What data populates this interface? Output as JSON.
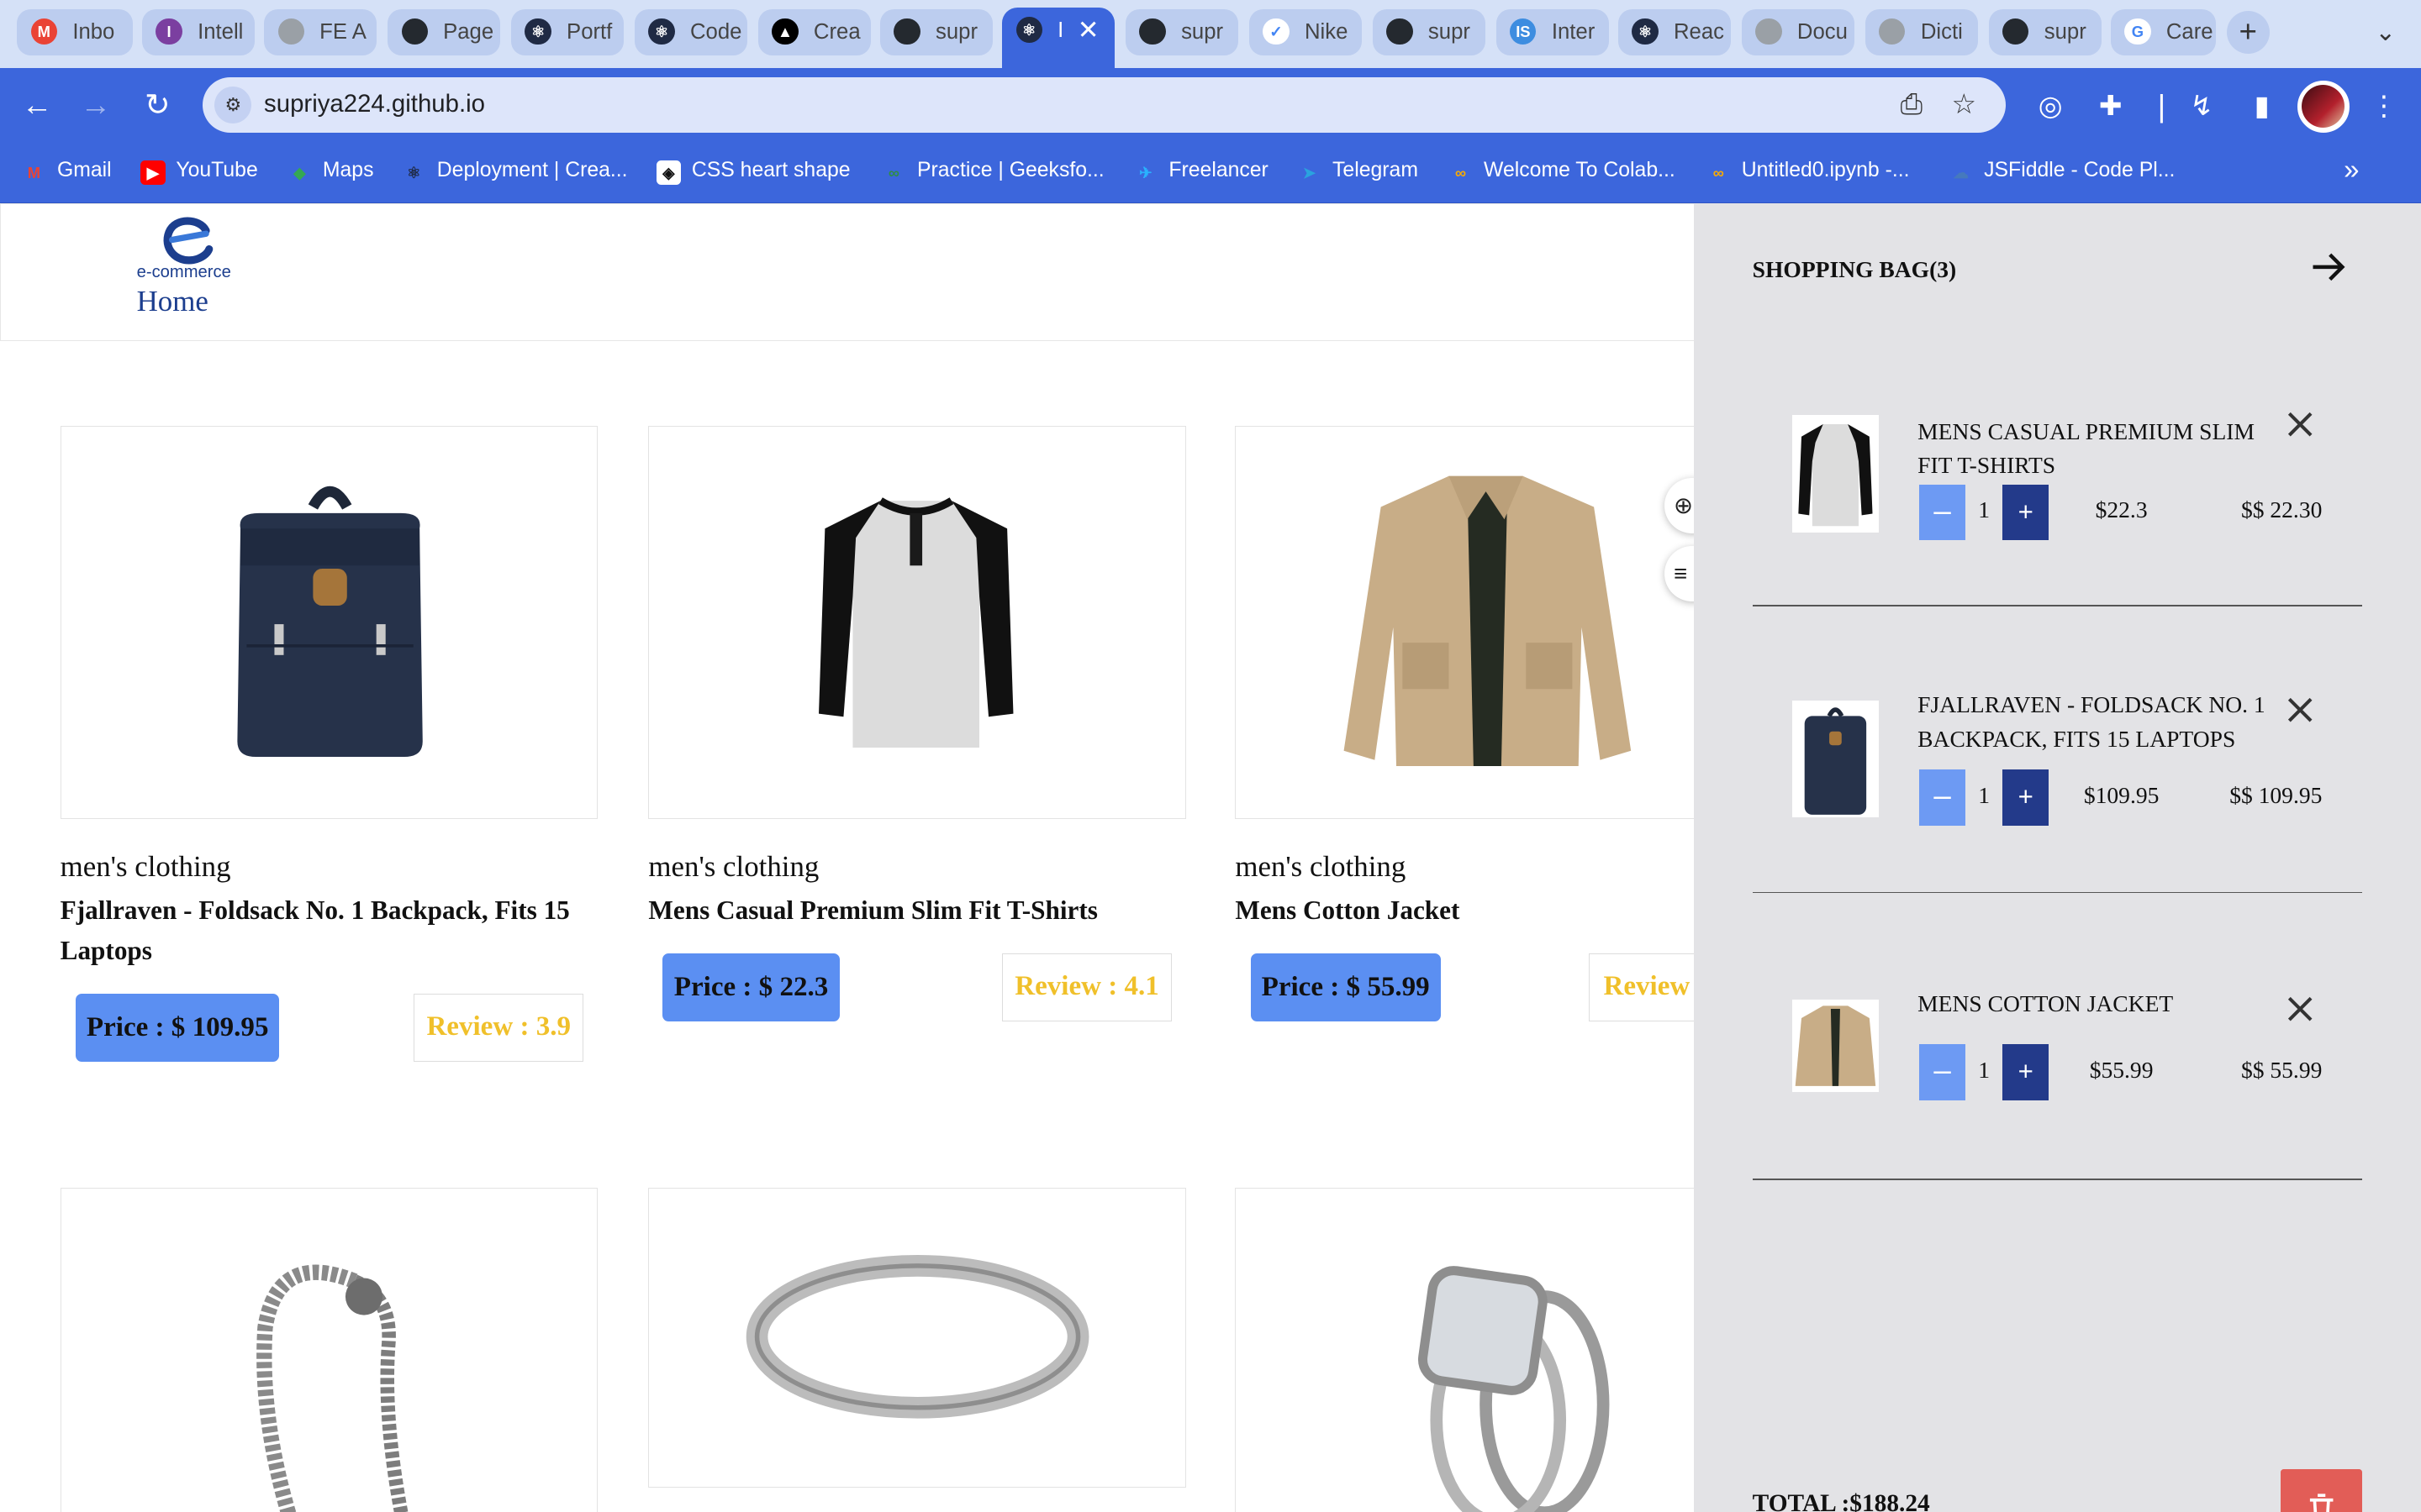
{
  "browser": {
    "tabs": [
      {
        "label": "Inbo",
        "icon": "gmail-icon",
        "color": "#ea4335",
        "glyph": "M"
      },
      {
        "label": "Intell",
        "icon": "intellipaat-icon",
        "color": "#7b3fa0",
        "glyph": "I"
      },
      {
        "label": "FE A",
        "icon": "globe-icon",
        "color": "#9aa0a6",
        "glyph": ""
      },
      {
        "label": "Page",
        "icon": "github-icon",
        "color": "#24292f",
        "glyph": ""
      },
      {
        "label": "Portf",
        "icon": "react-icon",
        "color": "#1f2a44",
        "glyph": "⚛"
      },
      {
        "label": "Code",
        "icon": "react-icon",
        "color": "#1f2a44",
        "glyph": "⚛"
      },
      {
        "label": "Crea",
        "icon": "vercel-icon",
        "color": "#000000",
        "glyph": "▲"
      },
      {
        "label": "supr",
        "icon": "github-icon",
        "color": "#24292f",
        "glyph": ""
      },
      {
        "label": "I",
        "icon": "react-icon",
        "color": "#1f2a44",
        "glyph": "⚛"
      },
      {
        "label": "supr",
        "icon": "github-icon",
        "color": "#24292f",
        "glyph": ""
      },
      {
        "label": "Nike",
        "icon": "nike-icon",
        "color": "#ffffff",
        "glyph": "✓"
      },
      {
        "label": "supr",
        "icon": "github-icon",
        "color": "#24292f",
        "glyph": ""
      },
      {
        "label": "Inter",
        "icon": "interviewbit-icon",
        "color": "#3d8de0",
        "glyph": "IS"
      },
      {
        "label": "Reac",
        "icon": "react-icon",
        "color": "#1f2a44",
        "glyph": "⚛"
      },
      {
        "label": "Docu",
        "icon": "globe-icon",
        "color": "#9aa0a6",
        "glyph": ""
      },
      {
        "label": "Dicti",
        "icon": "globe-icon",
        "color": "#9aa0a6",
        "glyph": ""
      },
      {
        "label": "supr",
        "icon": "github-icon",
        "color": "#24292f",
        "glyph": ""
      },
      {
        "label": "Care",
        "icon": "google-icon",
        "color": "#ffffff",
        "glyph": "G"
      }
    ],
    "url": "supriya224.github.io",
    "bookmarks": [
      {
        "label": "Gmail",
        "icon": "gmail-icon",
        "color": "#ea4335",
        "glyph": "M"
      },
      {
        "label": "YouTube",
        "icon": "youtube-icon",
        "color": "#ff0000",
        "glyph": "▶"
      },
      {
        "label": "Maps",
        "icon": "maps-icon",
        "color": "#34a853",
        "glyph": "◆"
      },
      {
        "label": "Deployment | Crea...",
        "icon": "react-icon",
        "color": "#1f2a44",
        "glyph": "⚛"
      },
      {
        "label": "CSS heart shape",
        "icon": "codepen-icon",
        "color": "#ffffff",
        "glyph": "◈"
      },
      {
        "label": "Practice | Geeksfo...",
        "icon": "geeksforgeeks-icon",
        "color": "#2f8d46",
        "glyph": "∞"
      },
      {
        "label": "Freelancer",
        "icon": "freelancer-icon",
        "color": "#29b2fe",
        "glyph": "✈"
      },
      {
        "label": "Telegram",
        "icon": "telegram-icon",
        "color": "#2aa3df",
        "glyph": "➤"
      },
      {
        "label": "Welcome To Colab...",
        "icon": "colab-icon",
        "color": "#f9ab00",
        "glyph": "∞"
      },
      {
        "label": "Untitled0.ipynb -...",
        "icon": "colab-icon",
        "color": "#f9ab00",
        "glyph": "∞"
      },
      {
        "label": "JSFiddle - Code Pl...",
        "icon": "jsfiddle-icon",
        "color": "#4679bd",
        "glyph": "☁"
      }
    ]
  },
  "site": {
    "logo_text": "e-commerce",
    "home_label": "Home",
    "brand_color": "#1c3e8e",
    "products": [
      {
        "category": "men's clothing",
        "title": "Fjallraven - Foldsack No. 1 Backpack, Fits 15 Laptops",
        "price": "Price : $ 109.95",
        "review": "Review : 3.9",
        "image": "backpack"
      },
      {
        "category": "men's clothing",
        "title": "Mens Casual Premium Slim Fit T-Shirts",
        "price": "Price : $ 22.3",
        "review": "Review : 4.1",
        "image": "tshirt"
      },
      {
        "category": "men's clothing",
        "title": "Mens Cotton Jacket",
        "price": "Price : $ 55.99",
        "review": "Review",
        "image": "jacket"
      },
      {
        "image": "bracelet"
      },
      {
        "image": "ring"
      },
      {
        "image": "diamond-ring"
      }
    ]
  },
  "cart": {
    "title": "SHOPPING BAG(3)",
    "items": [
      {
        "name": "MENS CASUAL PREMIUM SLIM FIT T-SHIRTS",
        "qty": "1",
        "unit_price": "$22.3",
        "line_total": "$$ 22.30",
        "image": "tshirt"
      },
      {
        "name": "FJALLRAVEN - FOLDSACK NO. 1 BACKPACK, FITS 15 LAPTOPS",
        "qty": "1",
        "unit_price": "$109.95",
        "line_total": "$$ 109.95",
        "image": "backpack"
      },
      {
        "name": "MENS COTTON JACKET",
        "qty": "1",
        "unit_price": "$55.99",
        "line_total": "$$ 55.99",
        "image": "jacket"
      }
    ],
    "total_label": "TOTAL :$188.24",
    "minus_glyph": "–",
    "plus_glyph": "+"
  }
}
